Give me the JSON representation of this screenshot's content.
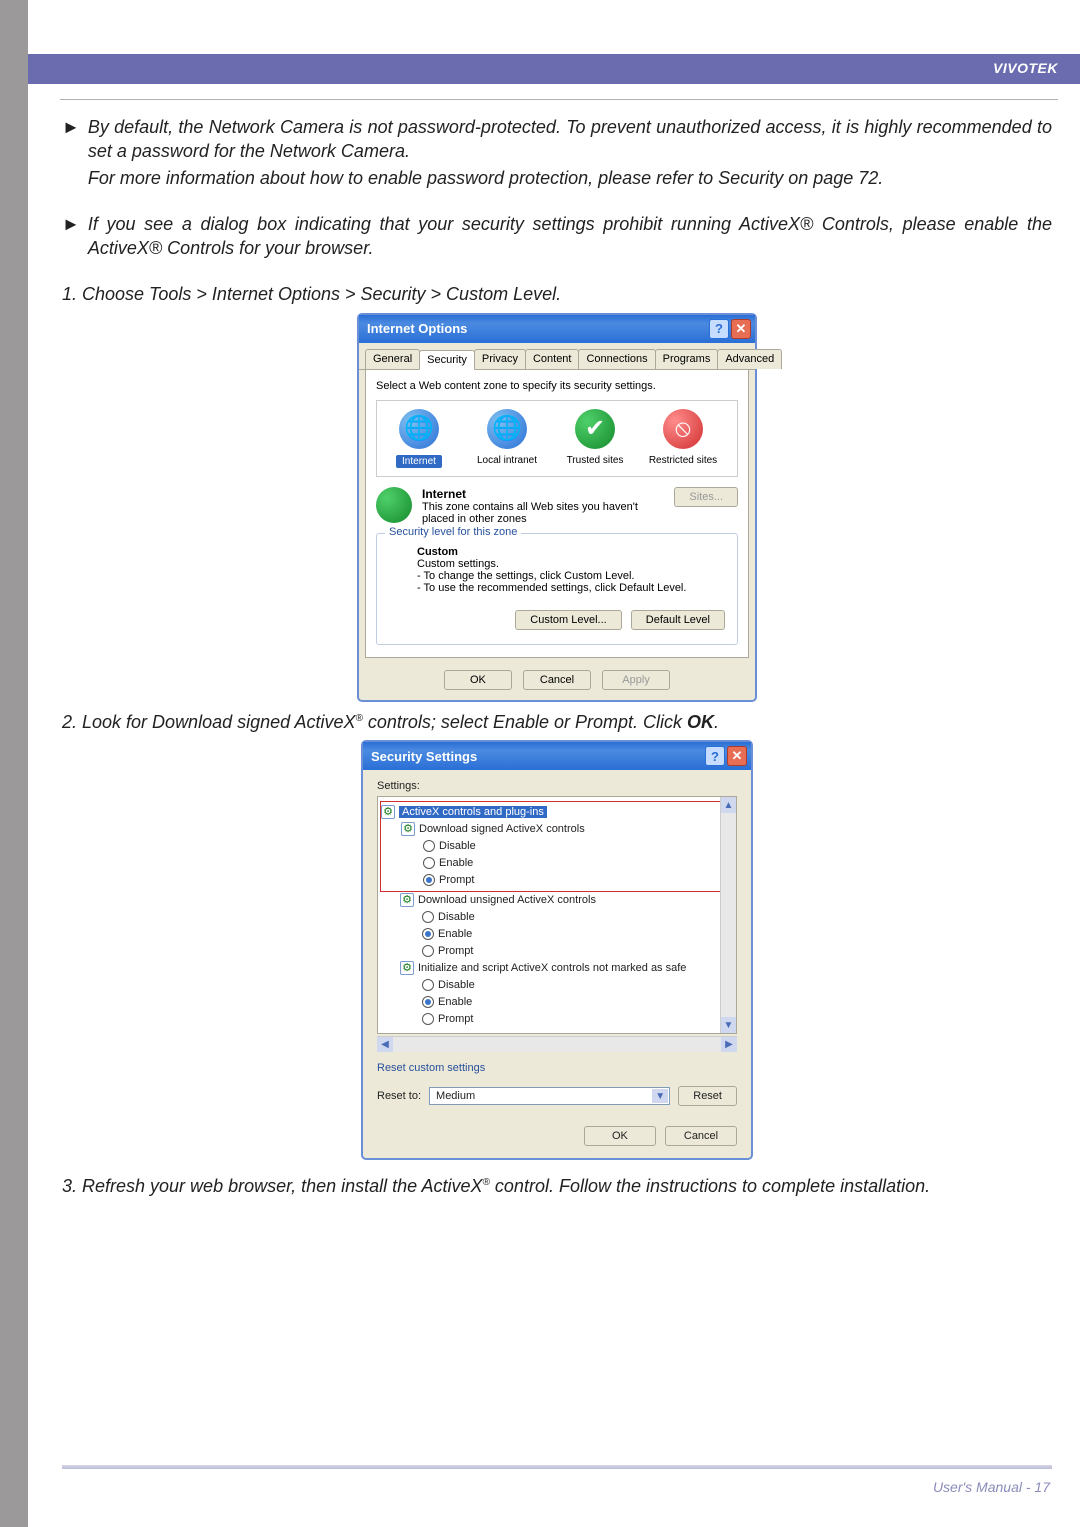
{
  "brand": "VIVOTEK",
  "bullets": [
    {
      "lines": [
        "By default, the Network Camera is not password-protected. To prevent unauthorized access, it is highly recommended to set a password for the Network Camera.",
        "For more information about how to enable password protection, please refer to Security on page 72."
      ]
    },
    {
      "lines": [
        "If you see a dialog box indicating that your security settings prohibit running ActiveX® Controls, please enable the ActiveX® Controls for your browser."
      ]
    }
  ],
  "steps": {
    "s1": "1. Choose Tools > Internet Options > Security > Custom Level.",
    "s2_pre": "2. Look for Download signed ActiveX",
    "s2_post": " controls; select Enable or Prompt. Click ",
    "s2_ok": "OK",
    "s2_end": ".",
    "s3_pre": "3. Refresh your web browser, then install the ActiveX",
    "s3_post": " control. Follow the instructions to complete installation."
  },
  "ie": {
    "title": "Internet Options",
    "help": "?",
    "close": "✕",
    "tabs": [
      "General",
      "Security",
      "Privacy",
      "Content",
      "Connections",
      "Programs",
      "Advanced"
    ],
    "instruction": "Select a Web content zone to specify its security settings.",
    "zones": [
      {
        "label": "Internet",
        "icon": "globe",
        "selected": true
      },
      {
        "label": "Local intranet",
        "icon": "globe"
      },
      {
        "label": "Trusted sites",
        "icon": "check"
      },
      {
        "label": "Restricted sites",
        "icon": "restrict"
      }
    ],
    "zone_detail_title": "Internet",
    "zone_detail_desc": "This zone contains all Web sites you haven't placed in other zones",
    "sites_btn": "Sites...",
    "fieldset_legend": "Security level for this zone",
    "custom_heading": "Custom",
    "custom_line": "Custom settings.",
    "custom_b1": "- To change the settings, click Custom Level.",
    "custom_b2": "- To use the recommended settings, click Default Level.",
    "custom_level_btn": "Custom Level...",
    "default_level_btn": "Default Level",
    "ok": "OK",
    "cancel": "Cancel",
    "apply": "Apply"
  },
  "sec": {
    "title": "Security Settings",
    "settings_label": "Settings:",
    "tree": {
      "root": "ActiveX controls and plug-ins",
      "g1": "Download signed ActiveX controls",
      "g2": "Download unsigned ActiveX controls",
      "g3": "Initialize and script ActiveX controls not marked as safe",
      "opt_disable": "Disable",
      "opt_enable": "Enable",
      "opt_prompt": "Prompt"
    },
    "reset_header": "Reset custom settings",
    "reset_to": "Reset to:",
    "reset_value": "Medium",
    "reset_btn": "Reset",
    "ok": "OK",
    "cancel": "Cancel"
  },
  "footer": "User's Manual - 17"
}
